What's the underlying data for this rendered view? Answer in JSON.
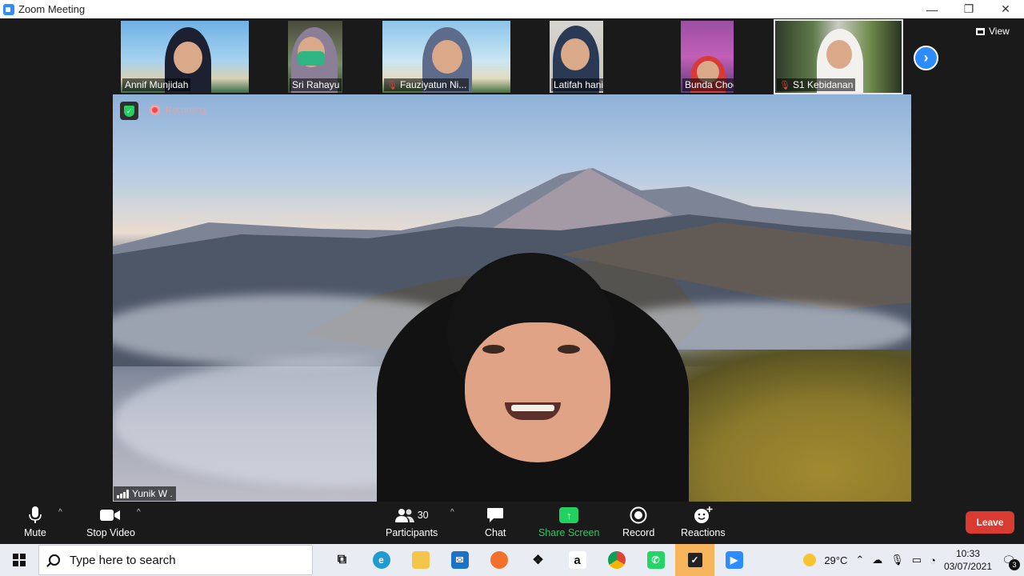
{
  "window": {
    "title": "Zoom Meeting",
    "minimize": "—",
    "maximize": "❐",
    "close": "✕"
  },
  "gallery": {
    "participants": [
      {
        "name": "Annif Munjidah",
        "muted": false
      },
      {
        "name": "Sri Rahayu",
        "muted": false
      },
      {
        "name": "Fauziyatun Ni...",
        "muted": true
      },
      {
        "name": "Latifah hanim R...",
        "muted": false
      },
      {
        "name": "Bunda Chodijah",
        "muted": false
      },
      {
        "name": "S1 Kebidanan",
        "muted": true
      }
    ],
    "view_label": "View",
    "next_icon": "chevron-right-icon"
  },
  "main_video": {
    "speaker_name": "Yunik W .",
    "recording_label": "Recording"
  },
  "toolbar": {
    "mute_label": "Mute",
    "stop_video_label": "Stop Video",
    "participants_label": "Participants",
    "participants_count": "30",
    "chat_label": "Chat",
    "share_label": "Share Screen",
    "record_label": "Record",
    "reactions_label": "Reactions",
    "leave_label": "Leave"
  },
  "taskbar": {
    "search_placeholder": "Type here to search",
    "temperature": "29°C",
    "time": "10:33",
    "date": "03/07/2021",
    "notification_count": "3"
  },
  "colors": {
    "accent": "#2d8cff",
    "share_green": "#23d160",
    "leave_red": "#d93a32",
    "meeting_bg": "#1a1a1a"
  }
}
